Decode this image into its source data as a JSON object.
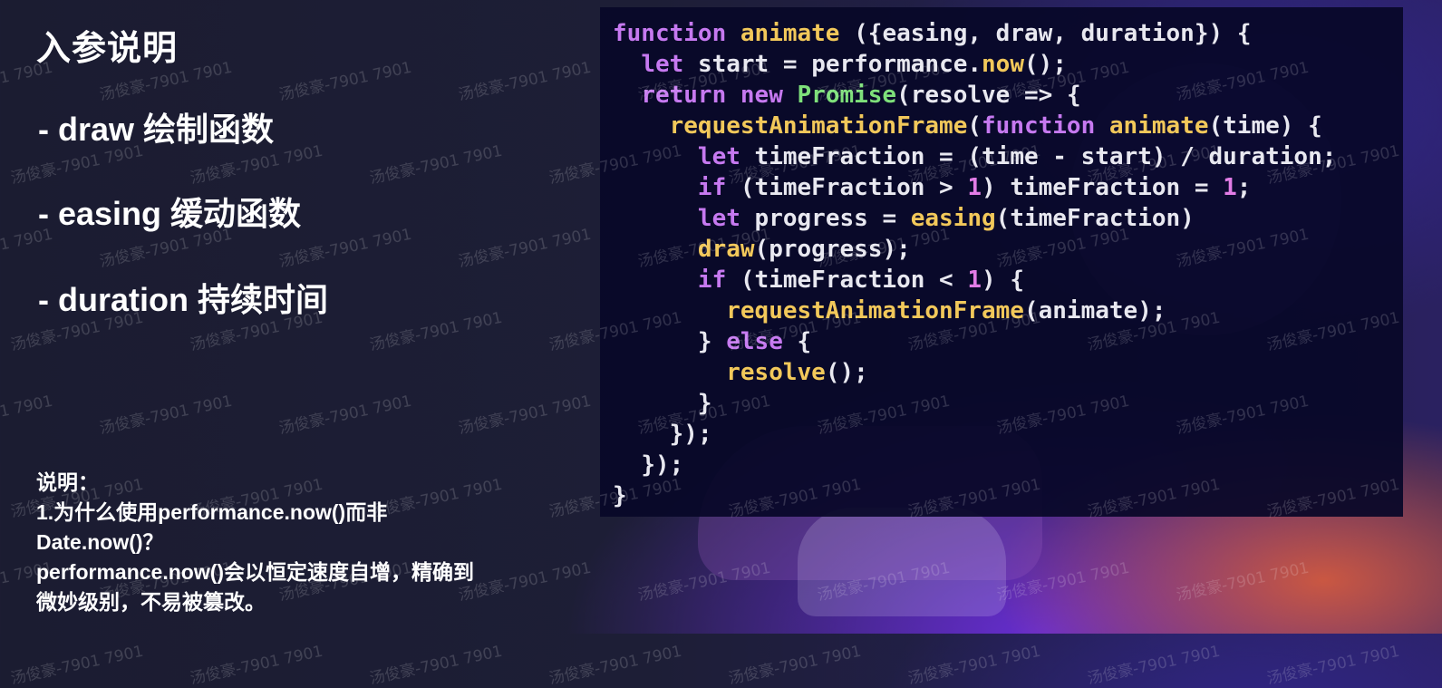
{
  "slide": {
    "heading": "入参说明",
    "bullets": [
      "- draw 绘制函数",
      "- easing 缓动函数",
      "- duration 持续时间"
    ],
    "note_lines": [
      "说明：",
      "1.为什么使用performance.now()而非",
      "Date.now()？",
      "performance.now()会以恒定速度自增，精确到",
      "微妙级别，不易被篡改。"
    ]
  },
  "code_lines": [
    "function animate ({easing, draw, duration}) {",
    "  let start = performance.now();",
    "  return new Promise(resolve => {",
    "    requestAnimationFrame(function animate(time) {",
    "      let timeFraction = (time - start) / duration;",
    "      if (timeFraction > 1) timeFraction = 1;",
    "      let progress = easing(timeFraction)",
    "      draw(progress);",
    "      if (timeFraction < 1) {",
    "        requestAnimationFrame(animate);",
    "      } else {",
    "        resolve();",
    "      }",
    "    });",
    "  });",
    "}"
  ],
  "watermark": "汤俊豪-7901 7901",
  "colors": {
    "keyword": "#c679f0",
    "function": "#f2c85a",
    "class": "#7ee07a",
    "number": "#e27ce6",
    "text": "#e8e8f0"
  }
}
